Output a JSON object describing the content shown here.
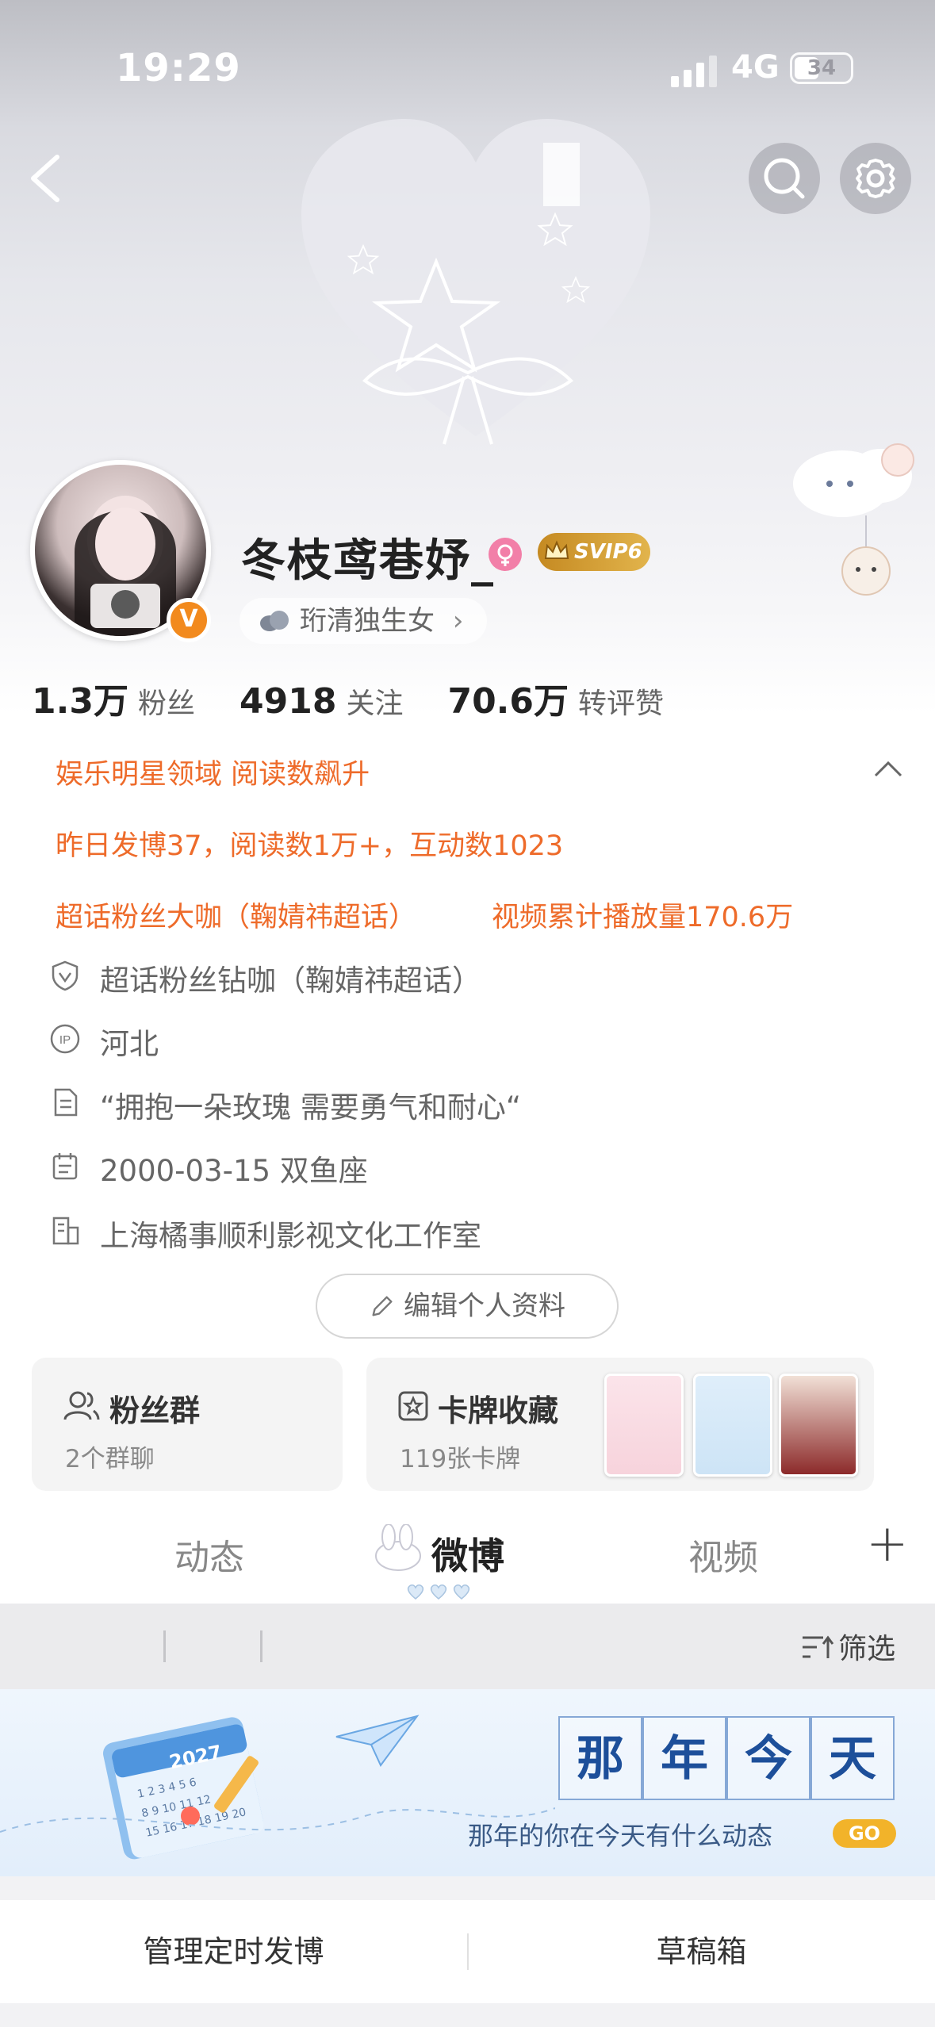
{
  "status_bar": {
    "time": "19:29",
    "network": "4G",
    "battery": "34"
  },
  "profile": {
    "username": "冬枝鸢巷妤_",
    "verified_mark": "V",
    "svip_label": "SVIP6",
    "tag_chip": "珩清独生女",
    "tag_chip_arrow": "›"
  },
  "stats": [
    {
      "value": "1.3万",
      "label": "粉丝"
    },
    {
      "value": "4918",
      "label": "关注"
    },
    {
      "value": "70.6万",
      "label": "转评赞"
    }
  ],
  "highlights": {
    "line1": "娱乐明星领域 阅读数飙升",
    "line2": "昨日发博37，阅读数1万+，互动数1023",
    "line3_left": "超话粉丝大咖（鞠婧祎超话）",
    "line3_right": "视频累计播放量170.6万"
  },
  "info": {
    "super_topic": "超话粉丝钻咖（鞠婧祎超话）",
    "ip": "河北",
    "bio": "“拥抱一朵玫瑰 需要勇气和耐心“",
    "birthday": "2000-03-15 双鱼座",
    "company": "上海橘事顺利影视文化工作室"
  },
  "edit_button": "编辑个人资料",
  "fan_group": {
    "title": "粉丝群",
    "sub": "2个群聊"
  },
  "card_collection": {
    "title": "卡牌收藏",
    "sub": "119张卡牌"
  },
  "tabs": {
    "feed": "动态",
    "weibo": "微博",
    "video": "视频",
    "add": "+"
  },
  "filter": {
    "label": "筛选"
  },
  "banner": {
    "grid_chars": [
      "那",
      "年",
      "今",
      "天"
    ],
    "subtitle": "那年的你在今天有什么动态",
    "go": "GO",
    "calendar_year": "2027"
  },
  "bottom": {
    "left": "管理定时发博",
    "right": "草稿箱"
  },
  "colors": {
    "orange": "#ee6b2a",
    "verify": "#f28a1e",
    "svip": "#c58a22",
    "banner_blue": "#1d4f9a"
  }
}
